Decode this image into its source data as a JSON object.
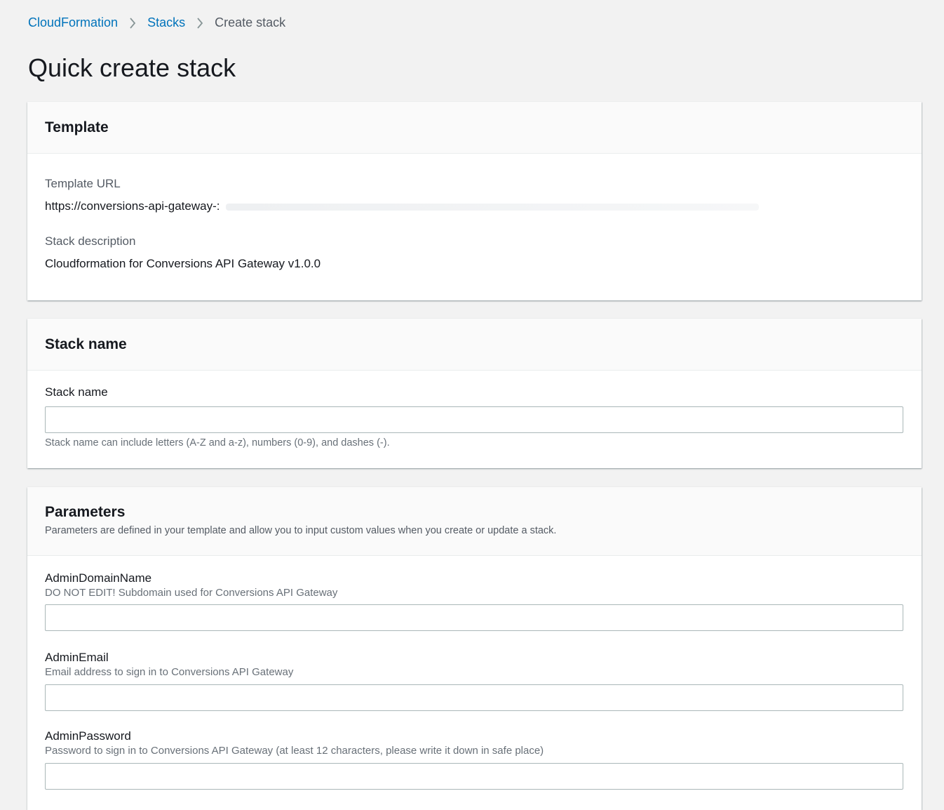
{
  "breadcrumb": {
    "items": [
      {
        "label": "CloudFormation"
      },
      {
        "label": "Stacks"
      }
    ],
    "current": "Create stack"
  },
  "page": {
    "title": "Quick create stack"
  },
  "template_panel": {
    "title": "Template",
    "url_label": "Template URL",
    "url_value": "https://conversions-api-gateway-:",
    "desc_label": "Stack description",
    "desc_value": "Cloudformation for Conversions API Gateway v1.0.0"
  },
  "stack_name_panel": {
    "title": "Stack name",
    "field_label": "Stack name",
    "field_value": "",
    "constraint": "Stack name can include letters (A-Z and a-z), numbers (0-9), and dashes (-)."
  },
  "parameters_panel": {
    "title": "Parameters",
    "description": "Parameters are defined in your template and allow you to input custom values when you create or update a stack.",
    "params": [
      {
        "name": "AdminDomainName",
        "description": "DO NOT EDIT! Subdomain used for Conversions API Gateway",
        "value": ""
      },
      {
        "name": "AdminEmail",
        "description": "Email address to sign in to Conversions API Gateway",
        "value": ""
      },
      {
        "name": "AdminPassword",
        "description": "Password to sign in to Conversions API Gateway (at least 12 characters, please write it down in safe place)",
        "value": ""
      }
    ]
  },
  "colors": {
    "link": "#0073bb",
    "background": "#f2f2f2",
    "panel_header": "#fafafa",
    "input_border": "#aab7b8"
  }
}
